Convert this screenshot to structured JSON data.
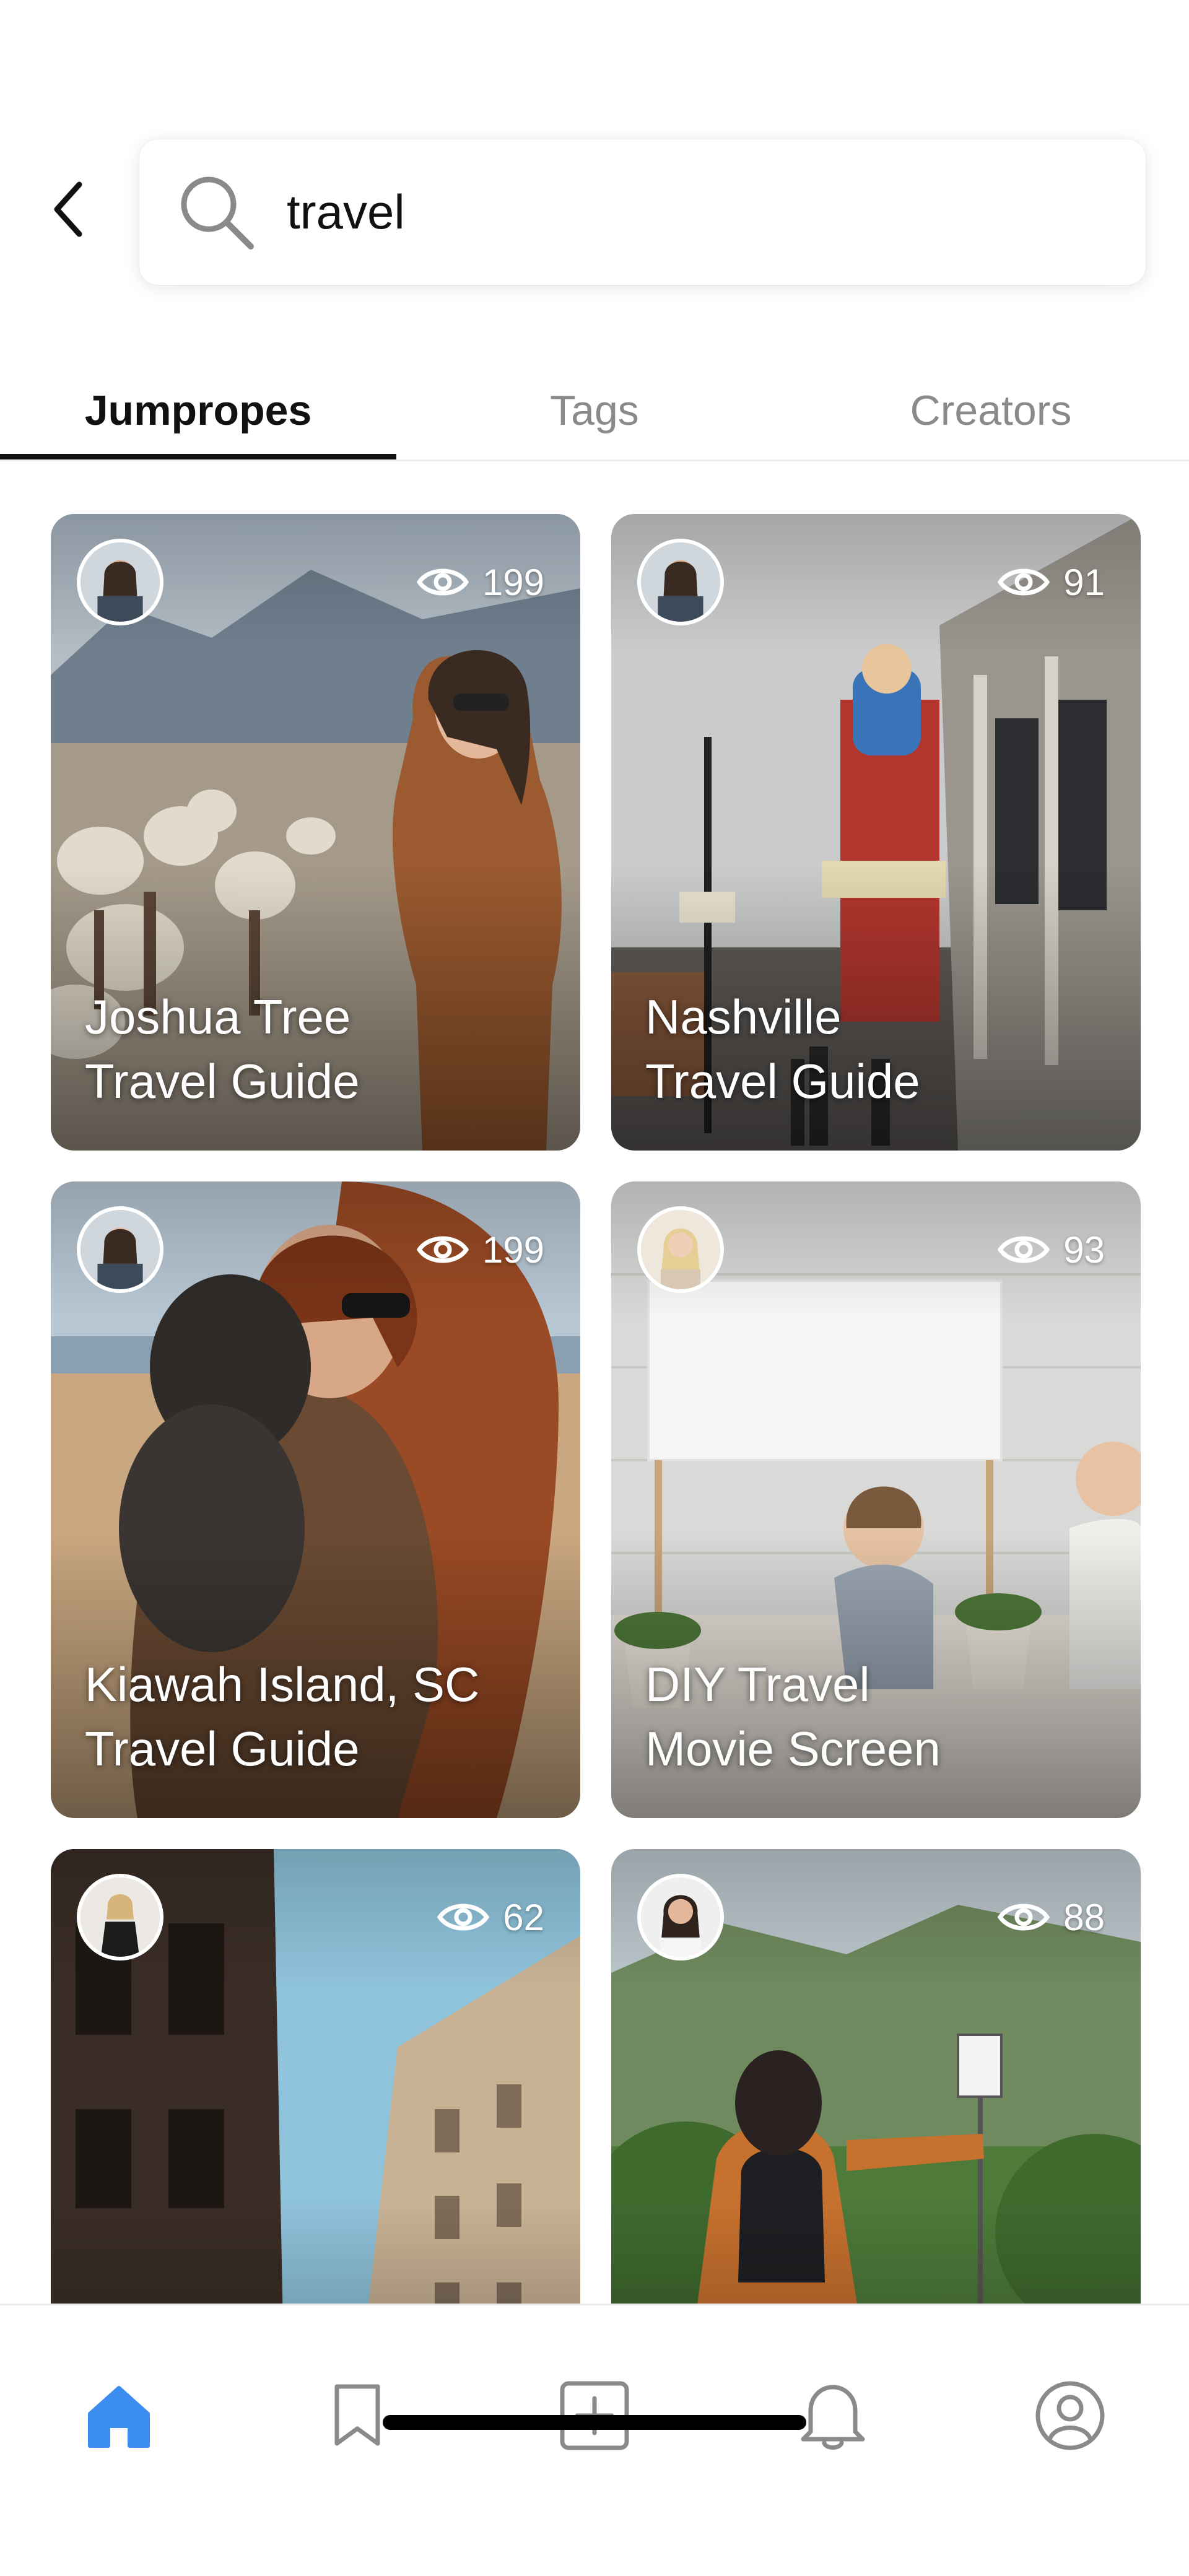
{
  "search": {
    "value": "travel",
    "placeholder": "Search"
  },
  "tabs": [
    {
      "label": "Jumpropes",
      "active": true
    },
    {
      "label": "Tags",
      "active": false
    },
    {
      "label": "Creators",
      "active": false
    }
  ],
  "cards": [
    {
      "title_line1": "Joshua Tree",
      "title_line2": "Travel Guide",
      "views": "199"
    },
    {
      "title_line1": "Nashville",
      "title_line2": "Travel Guide",
      "views": "91"
    },
    {
      "title_line1": "Kiawah Island, SC",
      "title_line2": "Travel Guide",
      "views": "199"
    },
    {
      "title_line1": "DIY Travel",
      "title_line2": "Movie Screen",
      "views": "93"
    },
    {
      "title_line1": "",
      "title_line2": "",
      "views": "62"
    },
    {
      "title_line1": "",
      "title_line2": "",
      "views": "88"
    }
  ],
  "bottom_nav": [
    {
      "icon": "home-icon",
      "active": true
    },
    {
      "icon": "bookmark-icon",
      "active": false
    },
    {
      "icon": "add-icon",
      "active": false
    },
    {
      "icon": "bell-icon",
      "active": false
    },
    {
      "icon": "profile-icon",
      "active": false
    }
  ],
  "colors": {
    "accent": "#3b8ef0",
    "inactive_icon": "#8a8a8a",
    "text": "#111111"
  }
}
